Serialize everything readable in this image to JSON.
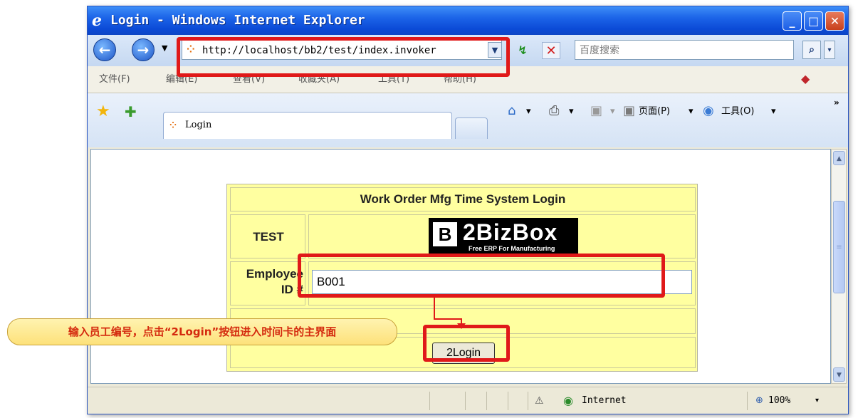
{
  "window": {
    "title": "Login - Windows Internet Explorer",
    "ie_icon": "e",
    "min_glyph": "_",
    "max_glyph": "□",
    "close_glyph": "✕"
  },
  "address_bar": {
    "back_glyph": "←",
    "forward_glyph": "→",
    "dropdown_glyph": "▼",
    "url": "http://localhost/bb2/test/index.invoker",
    "url_dropdown_glyph": "▼",
    "refresh_glyph": "↯",
    "stop_glyph": "✕",
    "search_placeholder": "百度搜索",
    "search_glyph": "⌕",
    "search_drop_glyph": "▾",
    "favicon_glyph": "⁘"
  },
  "menu": {
    "items": [
      "文件(F)",
      "编辑(E)",
      "查看(V)",
      "收藏夹(A)",
      "工具(T)",
      "帮助(H)"
    ],
    "tool_icon_glyph": "◆"
  },
  "tabs": {
    "fav_star_glyph": "★",
    "add_fav_glyph": "✚",
    "active_tab_label": "Login",
    "tab_favicon_glyph": "⁘",
    "home_glyph": "⌂",
    "print_glyph": "⎙",
    "feeds_glyph": "▣",
    "page_label": "页面(P)",
    "tools_label": "工具(O)",
    "dropdown_glyph": "▾",
    "chevron_glyph": "»"
  },
  "scrollbar": {
    "up_glyph": "▲",
    "thumb_grip": "≡",
    "down_glyph": "▼"
  },
  "form": {
    "title": "Work Order Mfg Time System Login",
    "company": "TEST",
    "logo": {
      "mark": "B",
      "name": "2BizBox",
      "tagline": "Free ERP For Manufacturing"
    },
    "employee_label_line1": "Employee",
    "employee_label_line2": "ID #",
    "employee_value": "B001",
    "login_button": "2Login"
  },
  "statusbar": {
    "security_glyph": "⚠",
    "globe_glyph": "◉",
    "zone": "Internet",
    "zoom_glyph": "⊕",
    "zoom": "100%",
    "zoom_drop_glyph": "▾"
  },
  "callout": {
    "text": "输入员工编号，点击“2Login”按钮进入时间卡的主界面"
  },
  "colors": {
    "highlight": "#e01919",
    "form_bg": "#ffffa0",
    "titlebar": "#1c64e8",
    "callout_text": "#d42a0e"
  }
}
